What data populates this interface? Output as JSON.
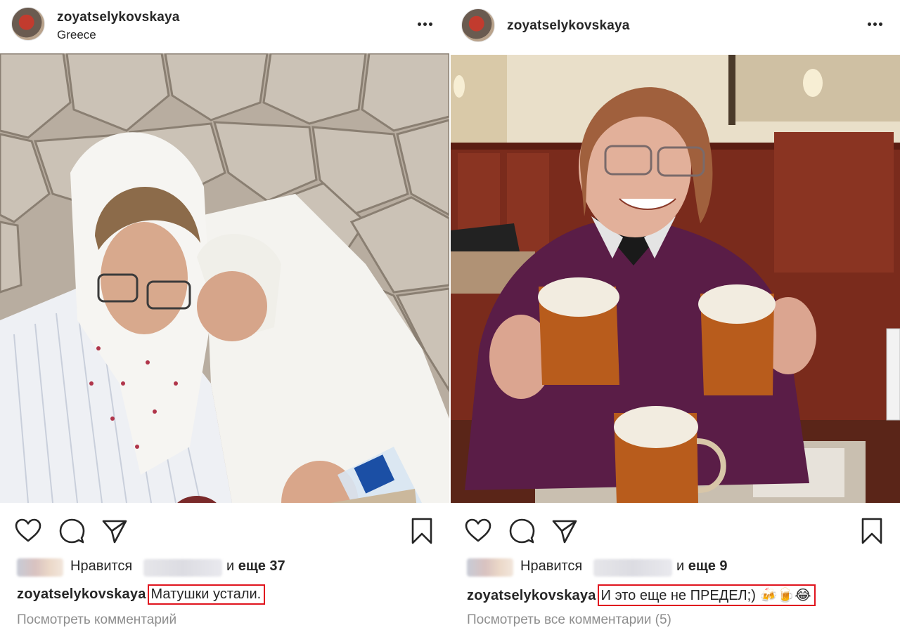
{
  "posts": [
    {
      "username": "zoyatselykovskaya",
      "location": "Greece",
      "likes_prefix": "Нравится",
      "likes_and": "и",
      "likes_more": "еще 37",
      "caption_user": "zoyatselykovskaya",
      "caption_text": "Матушки устали.",
      "view_comments": "Посмотреть комментарий"
    },
    {
      "username": "zoyatselykovskaya",
      "location": "",
      "likes_prefix": "Нравится",
      "likes_and": "и",
      "likes_more": "еще 9",
      "caption_user": "zoyatselykovskaya",
      "caption_text": "И это еще не ПРЕДЕЛ;) 🍻🍺😂",
      "view_comments": "Посмотреть все комментарии (5)"
    }
  ],
  "icons": {
    "more": "more-options-icon",
    "like": "heart-icon",
    "comment": "comment-icon",
    "share": "direct-share-icon",
    "save": "bookmark-icon"
  },
  "colors": {
    "text": "#262626",
    "muted": "#8e8e8e",
    "highlight_box": "#e0141e"
  }
}
